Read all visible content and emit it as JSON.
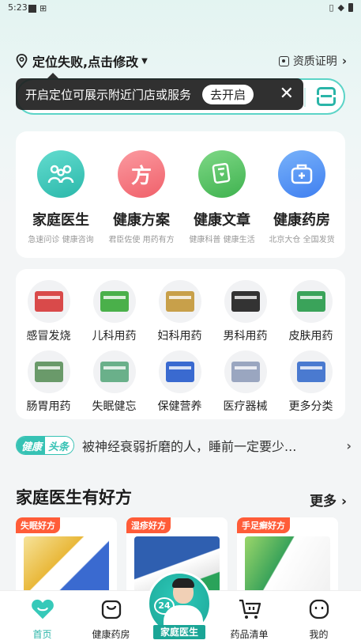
{
  "status_bar": {
    "time": "5:23"
  },
  "location": {
    "label": "定位失败,点击修改",
    "qualification": "资质证明"
  },
  "toast": {
    "message": "开启定位可展示附近门店或服务",
    "action": "去开启"
  },
  "services": [
    {
      "title": "家庭医生",
      "subtitle": "急速问诊 健康咨询",
      "icon": "family-doctor-icon",
      "color": "#3cc9bc"
    },
    {
      "title": "健康方案",
      "subtitle": "君臣佐使 用药有方",
      "icon": "health-plan-icon",
      "color": "#f5727a",
      "glyph": "方"
    },
    {
      "title": "健康文章",
      "subtitle": "健康科普 健康生活",
      "icon": "article-icon",
      "color": "#5cc66b"
    },
    {
      "title": "健康药房",
      "subtitle": "北京大仓 全国发货",
      "icon": "pharmacy-icon",
      "color": "#4a8df0"
    }
  ],
  "categories": [
    {
      "label": "感冒发烧",
      "color": "#d94a4a"
    },
    {
      "label": "儿科用药",
      "color": "#4ab04a"
    },
    {
      "label": "妇科用药",
      "color": "#c8a04a"
    },
    {
      "label": "男科用药",
      "color": "#333333"
    },
    {
      "label": "皮肤用药",
      "color": "#3aa35a"
    },
    {
      "label": "肠胃用药",
      "color": "#6a9a6a"
    },
    {
      "label": "失眠健忘",
      "color": "#6ab08a"
    },
    {
      "label": "保健营养",
      "color": "#3a6ad0"
    },
    {
      "label": "医疗器械",
      "color": "#9aa6c0"
    },
    {
      "label": "更多分类",
      "color": "#4a7ad0"
    }
  ],
  "news": {
    "badge_a": "健康",
    "badge_b": "头条",
    "text": "被神经衰弱折磨的人，睡前一定要少..."
  },
  "section": {
    "title": "家庭医生有好方",
    "more": "更多"
  },
  "products": [
    {
      "tag": "失眠好方",
      "color": "#e9b83a"
    },
    {
      "tag": "湿疹好方",
      "color": "#2f5fb0"
    },
    {
      "tag": "手足癣好方",
      "color": "#3aa35a"
    }
  ],
  "tabbar": [
    {
      "label": "首页",
      "icon": "heart-icon"
    },
    {
      "label": "健康药房",
      "icon": "bag-icon"
    },
    {
      "label": "家庭医生",
      "icon": "doctor-avatar"
    },
    {
      "label": "药品清单",
      "icon": "cart-icon"
    },
    {
      "label": "我的",
      "icon": "face-icon"
    }
  ]
}
